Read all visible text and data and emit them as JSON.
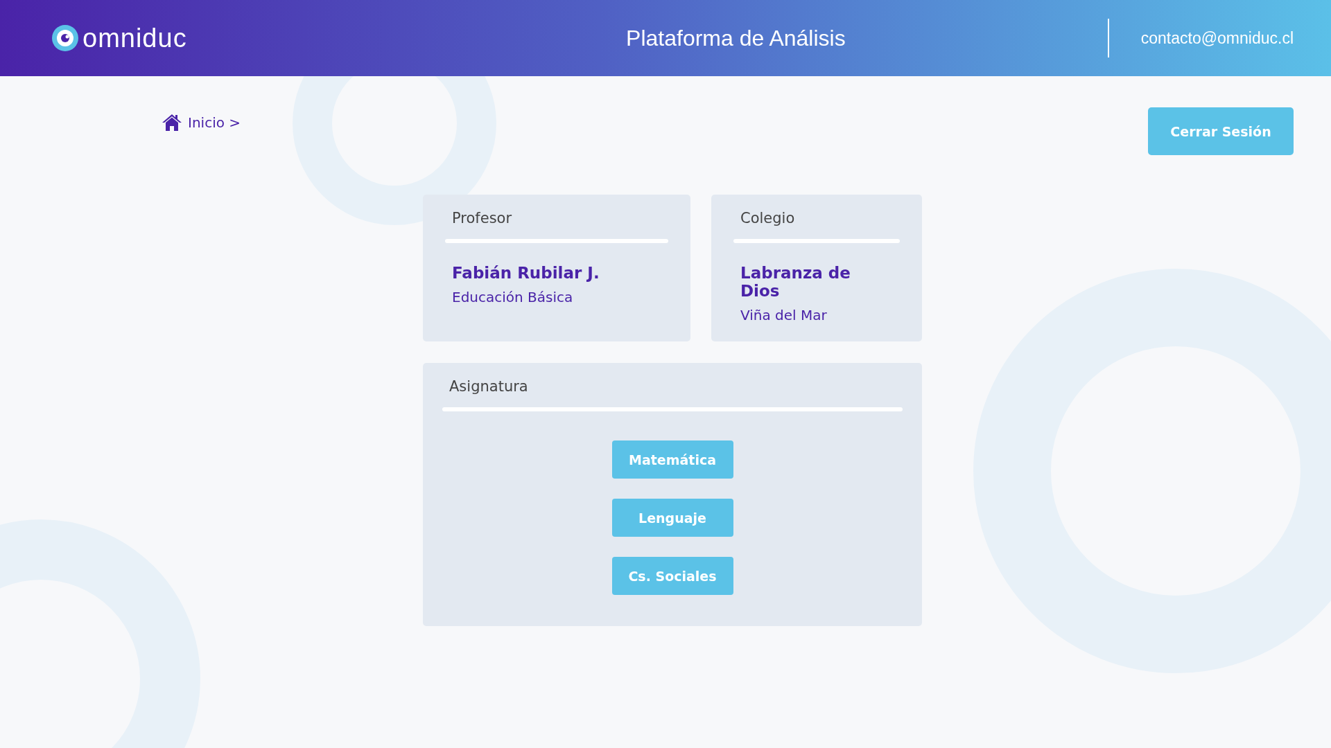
{
  "header": {
    "logo_text": "omniduc",
    "title": "Plataforma de Análisis",
    "email": "contacto@omniduc.cl"
  },
  "breadcrumb": [
    {
      "label": "Inicio",
      "separator": ">"
    }
  ],
  "logout_button": "Cerrar Sesión",
  "cards": [
    {
      "heading": "Profesor",
      "primary": "Fabián Rubilar J.",
      "secondary": "Educación Básica"
    },
    {
      "heading": "Colegio",
      "primary": "Labranza de Dios",
      "secondary": "Viña del Mar"
    }
  ],
  "subjects": {
    "heading": "Asignatura",
    "buttons": [
      "Matemática",
      "Lenguaje",
      "Cs. Sociales"
    ]
  }
}
